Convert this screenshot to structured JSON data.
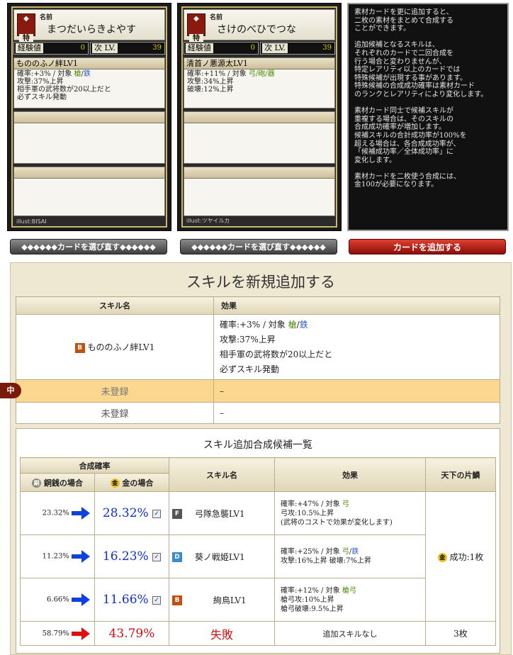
{
  "cards": [
    {
      "name_label": "名前",
      "rarity_badge": "特",
      "name": "まつだいらきよやす",
      "exp_label": "経験値",
      "exp_value": "0",
      "next_label": "次 LV.",
      "next_value": "39",
      "skill_title": "もののふノ絆LV1",
      "skill_lines": [
        {
          "pre": "確率:+3% / 対象 ",
          "a": "槍",
          "sep": "/",
          "b": "鉄"
        },
        {
          "text": "攻撃:37%上昇"
        },
        {
          "text": "相手軍の武将数が20以上だと"
        },
        {
          "text": "必ずスキル発動"
        }
      ],
      "illust": "illust:BISAI"
    },
    {
      "name_label": "名前",
      "rarity_badge": "特",
      "name": "さけのべひでつな",
      "exp_label": "経験値",
      "exp_value": "0",
      "next_label": "次 LV.",
      "next_value": "39",
      "skill_title": "清首ノ悪源太LV1",
      "skill_lines": [
        {
          "pre": "確率:+11% / 対象 ",
          "a": "弓/砲/器",
          "sep": "",
          "b": ""
        },
        {
          "text": "攻撃:34%上昇"
        },
        {
          "text": "破壊:12%上昇"
        }
      ],
      "illust": "illust:ツヤイルカ"
    }
  ],
  "description": "素材カードを更に追加すると、\n二枚の素材をまとめて合成する\nことができます。\n\n追加候補となるスキルは、\nそれぞれのカードで二回合成を\n行う場合と変わりませんが、\n特定レアリティ以上のカードでは\n特殊候補が出現する事があります。\n特殊候補の合成成功確率は素材カード\nのランクとレアリティにより変化します。\n\n素材カード同士で候補スキルが\n重複する場合は、そのスキルの\n合成成功確率が増加します。\n候補スキルの合計成功率が100%を\n超える場合は、各合成成功率が、\n「候補成功率／全体成功率」に\n変化します。\n\n素材カードを二枚使う合成には、\n金100が必要になります。",
  "buttons": {
    "reselect1": "◆◆◆◆◆◆カードを選び直す◆◆◆◆◆◆",
    "reselect2": "◆◆◆◆◆◆カードを選び直す◆◆◆◆◆◆",
    "add_card": "カードを追加する"
  },
  "section_title": "スキルを新規追加する",
  "new_skill_table": {
    "headers": [
      "スキル名",
      "効果"
    ],
    "row1": {
      "badge": "B",
      "name": "もののふノ絆LV1",
      "effect_line1_pre": "確率:+3% / 対象 ",
      "effect_line1_a": "槍",
      "effect_line1_sep": "/",
      "effect_line1_b": "鉄",
      "effect_lines": [
        "攻撃:37%上昇",
        "相手軍の武将数が20以上だと",
        "必ずスキル発動"
      ]
    },
    "row2": {
      "name": "未登録",
      "effect": "–",
      "side_tag": "中"
    },
    "row3": {
      "name": "未登録",
      "effect": "–"
    }
  },
  "candidates": {
    "title": "スキル追加合成候補一覧",
    "headers": {
      "rate": "合成確率",
      "copper": "銅銭の場合",
      "copper_coin": "銅",
      "gold": "金の場合",
      "gold_coin": "金",
      "skill": "スキル名",
      "effect": "効果",
      "fragment": "天下の片鱗"
    },
    "rows": [
      {
        "copper": "23.32%",
        "gold": "28.32%",
        "badge": "F",
        "badge_color": "#555555",
        "name": "弓隊急襲LV1",
        "effect": [
          {
            "pre": "確率:+47% / 対象 ",
            "a": "弓"
          },
          {
            "text": "弓攻:10.5%上昇"
          },
          {
            "text": "(武将のコストで効果が変化します)"
          }
        ]
      },
      {
        "copper": "11.23%",
        "gold": "16.23%",
        "badge": "D",
        "badge_color": "#3a8ad0",
        "name": "葵ノ戦姫LV1",
        "effect": [
          {
            "pre": "確率:+25% / 対象 ",
            "a": "弓",
            "sep": "/",
            "b": "鉄"
          },
          {
            "text": "攻撃:16%上昇 破壊:7%上昇"
          }
        ]
      },
      {
        "copper": "6.66%",
        "gold": "11.66%",
        "badge": "B",
        "badge_color": "#c05010",
        "name": "絢鳥LV1",
        "effect": [
          {
            "pre": "確率:+12% / 対象 ",
            "a": "槍弓"
          },
          {
            "text": "槍弓攻:10%上昇"
          },
          {
            "text": "槍弓破壊:9.5%上昇"
          }
        ]
      }
    ],
    "fragment_success": "成功:1枚",
    "fragment_coin": "金",
    "fail_row": {
      "copper": "58.79%",
      "gold": "43.79%",
      "name": "失敗",
      "effect": "追加スキルなし",
      "fragment": "3枚"
    }
  }
}
